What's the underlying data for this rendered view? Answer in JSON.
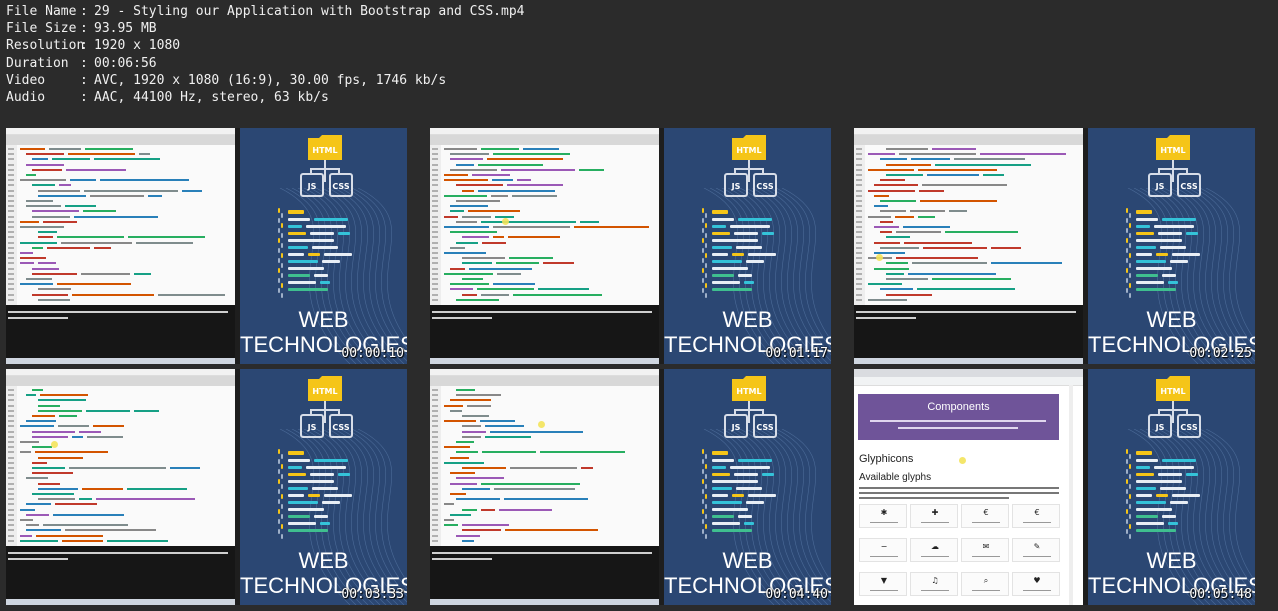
{
  "file_info": [
    {
      "key": "File Name",
      "value": "29 - Styling our Application with Bootstrap and CSS.mp4"
    },
    {
      "key": "File Size",
      "value": "93.95 MB"
    },
    {
      "key": "Resolution",
      "value": "1920 x 1080"
    },
    {
      "key": "Duration",
      "value": "00:06:56"
    },
    {
      "key": "Video",
      "value": "AVC, 1920 x 1080 (16:9), 30.00 fps, 1746 kb/s"
    },
    {
      "key": "Audio",
      "value": "AAC, 44100 Hz, stereo, 63 kb/s"
    }
  ],
  "separator": ":",
  "cover": {
    "html_label": "HTML",
    "js_label": "JS",
    "css_label": "CSS",
    "title_line1": "WEB",
    "title_line2": "TECHNOLOGIES"
  },
  "thumbnails": [
    {
      "timestamp": "00:00:10",
      "content": "editor"
    },
    {
      "timestamp": "00:01:17",
      "content": "editor"
    },
    {
      "timestamp": "00:02:25",
      "content": "editor"
    },
    {
      "timestamp": "00:03:33",
      "content": "editor"
    },
    {
      "timestamp": "00:04:40",
      "content": "editor"
    },
    {
      "timestamp": "00:05:48",
      "content": "browser"
    }
  ],
  "browser": {
    "hero_title": "Components",
    "heading": "Glyphicons",
    "subheading": "Available glyphs"
  },
  "colors": {
    "cover_bg": "#2b4773",
    "folder": "#f5c518",
    "bar_cyan": "#34c3d9",
    "bar_white": "#e8eef5",
    "bar_yellow": "#f5c518",
    "bar_green": "#3fbf8f",
    "hero_purple": "#6f5499"
  },
  "icons": [
    "folder-icon",
    "html-badge-icon",
    "js-box-icon",
    "css-box-icon",
    "code-brackets-icon",
    "mouse-cursor-icon"
  ]
}
